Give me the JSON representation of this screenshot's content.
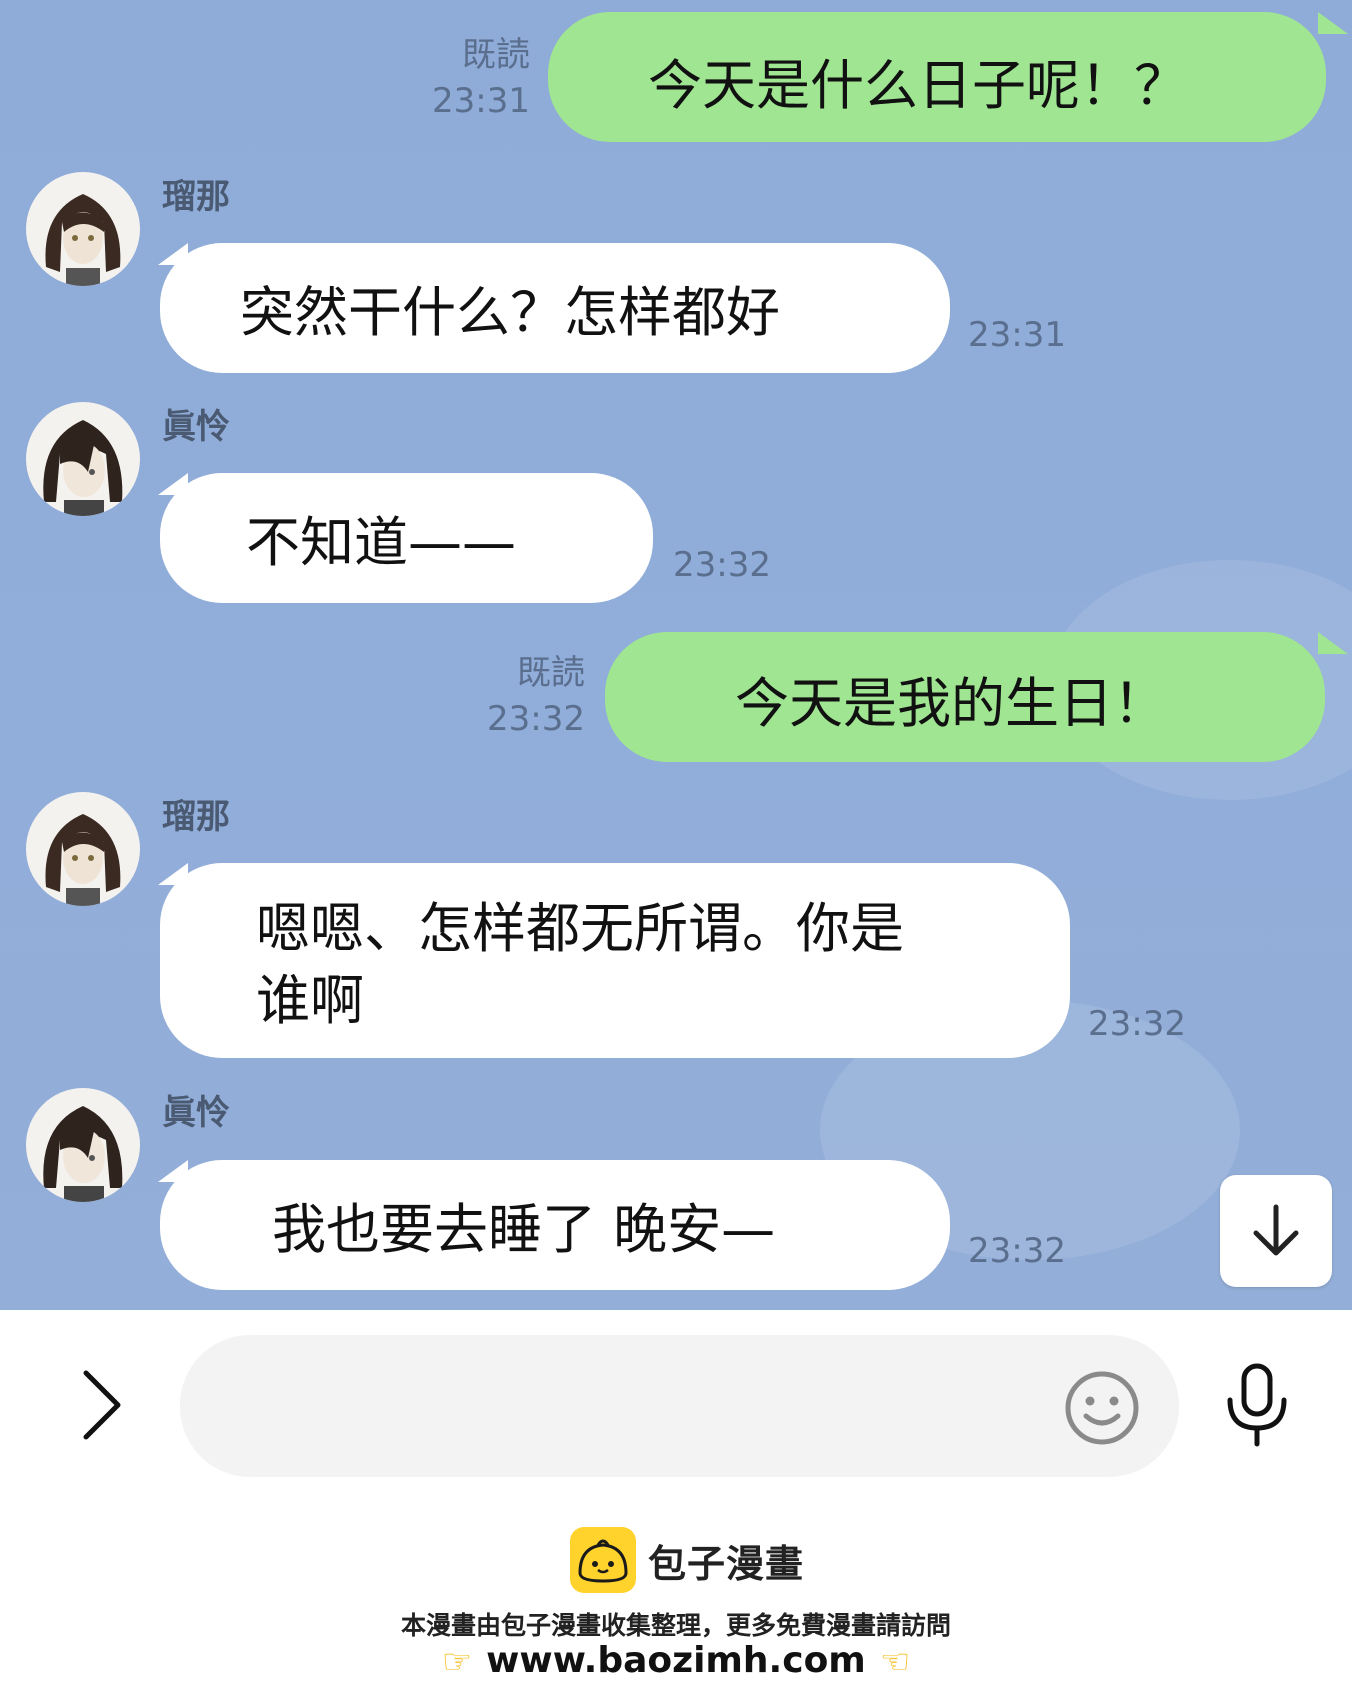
{
  "messages": [
    {
      "side": "out",
      "text": "今天是什么日子呢！？",
      "read": "既読",
      "time": "23:31"
    },
    {
      "side": "in",
      "sender": "瑠那",
      "text": "突然干什么？怎样都好",
      "time": "23:31"
    },
    {
      "side": "in",
      "sender": "眞怜",
      "text": "不知道——",
      "time": "23:32"
    },
    {
      "side": "out",
      "text": "今天是我的生日！",
      "read": "既読",
      "time": "23:32"
    },
    {
      "side": "in",
      "sender": "瑠那",
      "text_line1": "嗯嗯、怎样都无所谓。你是",
      "text_line2": "谁啊",
      "time": "23:32"
    },
    {
      "side": "in",
      "sender": "眞怜",
      "text": "我也要去睡了 晚安—",
      "time": "23:32"
    }
  ],
  "input": {
    "placeholder": "",
    "value": ""
  },
  "icons": {
    "expand": "chevron-right-icon",
    "emoji": "smiley-icon",
    "mic": "microphone-icon",
    "scroll": "arrow-down-icon"
  },
  "footer": {
    "brand": "包子漫畫",
    "notice": "本漫畫由包子漫畫收集整理，更多免費漫畫請訪問",
    "url": "www.baozimh.com"
  },
  "colors": {
    "chat_bg": "#91add9",
    "outgoing_bubble": "#a0e592",
    "incoming_bubble": "#ffffff",
    "meta_text": "#5a6e8e",
    "logo": "#ffd22c"
  }
}
